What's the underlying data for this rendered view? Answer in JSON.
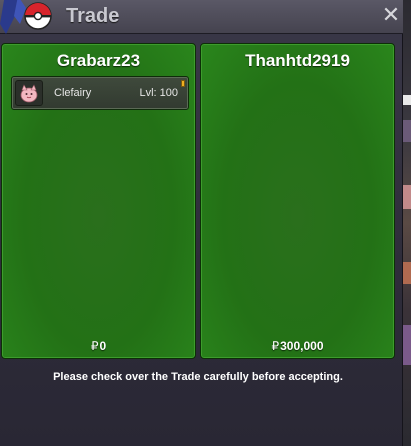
{
  "window": {
    "title": "Trade",
    "close_icon": "close-icon"
  },
  "left": {
    "trainer": "Grabarz23",
    "money_symbol": "₽",
    "money": "0",
    "pokemon": [
      {
        "name": "Clefairy",
        "level": "Lvl: 100",
        "icon": "clefairy-icon"
      }
    ]
  },
  "right": {
    "trainer": "Thanhtd2919",
    "money_symbol": "₽",
    "money": "300,000",
    "pokemon": []
  },
  "footer": {
    "message": "Please check over the Trade carefully before accepting."
  },
  "colors": {
    "panel_green": "#237116",
    "window_bg": "#2e2c3a",
    "title_text": "#c9c9d1"
  }
}
